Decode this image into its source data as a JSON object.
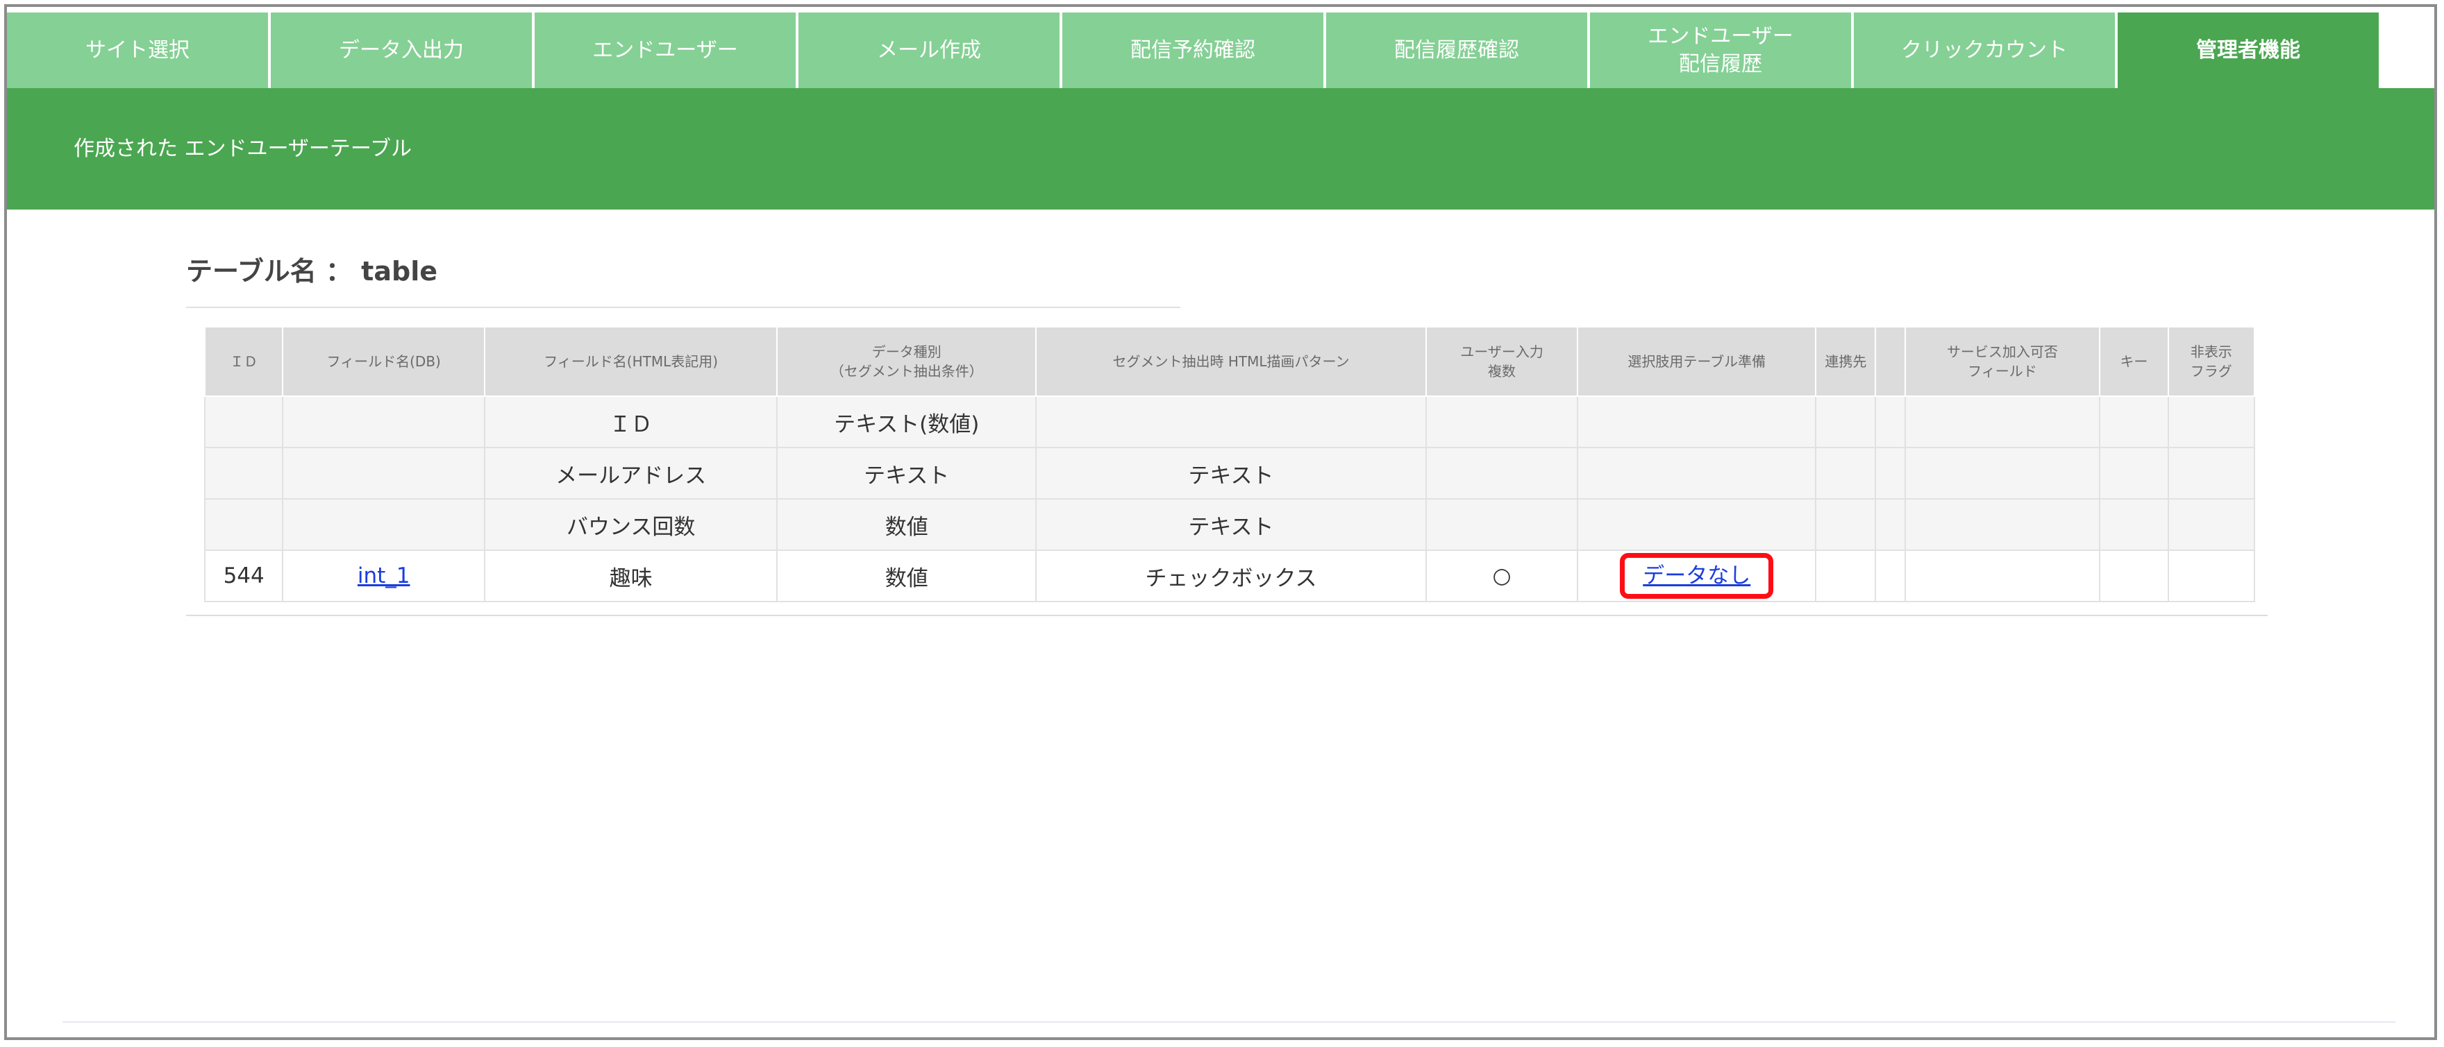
{
  "nav": {
    "tabs": [
      {
        "label": "サイト選択"
      },
      {
        "label": "データ入出力"
      },
      {
        "label": "エンドユーザー"
      },
      {
        "label": "メール作成"
      },
      {
        "label": "配信予約確認"
      },
      {
        "label": "配信履歴確認"
      },
      {
        "label": "エンドユーザー",
        "label2": "配信履歴"
      },
      {
        "label": "クリックカウント"
      },
      {
        "label": "管理者機能",
        "active": true
      }
    ]
  },
  "header": {
    "title": "作成された エンドユーザーテーブル"
  },
  "table_name": "テーブル名 ： table",
  "table": {
    "headers": [
      {
        "line1": "ＩＤ"
      },
      {
        "line1": "フィールド名(DB)"
      },
      {
        "line1": "フィールド名(HTML表記用)"
      },
      {
        "line1": "データ種別",
        "line2": "（セグメント抽出条件）"
      },
      {
        "line1": "セグメント抽出時 HTML描画パターン"
      },
      {
        "line1": "ユーザー入力",
        "line2": "複数"
      },
      {
        "line1": "選択肢用テーブル準備"
      },
      {
        "line1": "連携先"
      },
      {
        "line1": ""
      },
      {
        "line1": "サービス加入可否",
        "line2": "フィールド"
      },
      {
        "line1": "キー"
      },
      {
        "line1": "非表示",
        "line2": "フラグ"
      }
    ],
    "rows": [
      [
        "",
        "",
        "ＩＤ",
        "テキスト(数値)",
        "",
        "",
        "",
        "",
        "",
        "",
        "",
        ""
      ],
      [
        "",
        "",
        "メールアドレス",
        "テキスト",
        "テキスト",
        "",
        "",
        "",
        "",
        "",
        "",
        ""
      ],
      [
        "",
        "",
        "バウンス回数",
        "数値",
        "テキスト",
        "",
        "",
        "",
        "",
        "",
        "",
        ""
      ],
      [
        "544",
        "int_1",
        "趣味",
        "数値",
        "チェックボックス",
        "○",
        "データなし",
        "",
        "",
        "",
        "",
        ""
      ]
    ]
  },
  "colors": {
    "nav_tab": "#85d095",
    "nav_active": "#4aa651",
    "header_band": "#4aa651",
    "highlight": "#ff0d14",
    "link": "#1a3de0"
  }
}
